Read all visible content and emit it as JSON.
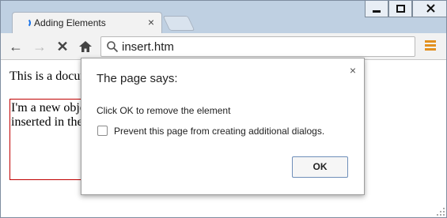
{
  "window": {
    "minimize_icon": "minimize-icon",
    "maximize_icon": "maximize-icon",
    "close_icon": "close-icon"
  },
  "tab": {
    "title": "Adding Elements",
    "close_glyph": "×",
    "loading_icon": "loading-spinner-icon"
  },
  "toolbar": {
    "back_glyph": "←",
    "forward_glyph": "→",
    "stop_glyph": "✕",
    "home_glyph": "⌂",
    "address": "insert.htm",
    "menu_color": "#e2901f"
  },
  "page": {
    "text": "This is a docum",
    "inserted_text": "I'm a new object inserted in the DOM",
    "box_border_color": "#c00000"
  },
  "dialog": {
    "title": "The page says:",
    "close_glyph": "×",
    "message": "Click OK to remove the element",
    "checkbox_label": "Prevent this page from creating additional dialogs.",
    "checkbox_checked": false,
    "ok_label": "OK"
  }
}
